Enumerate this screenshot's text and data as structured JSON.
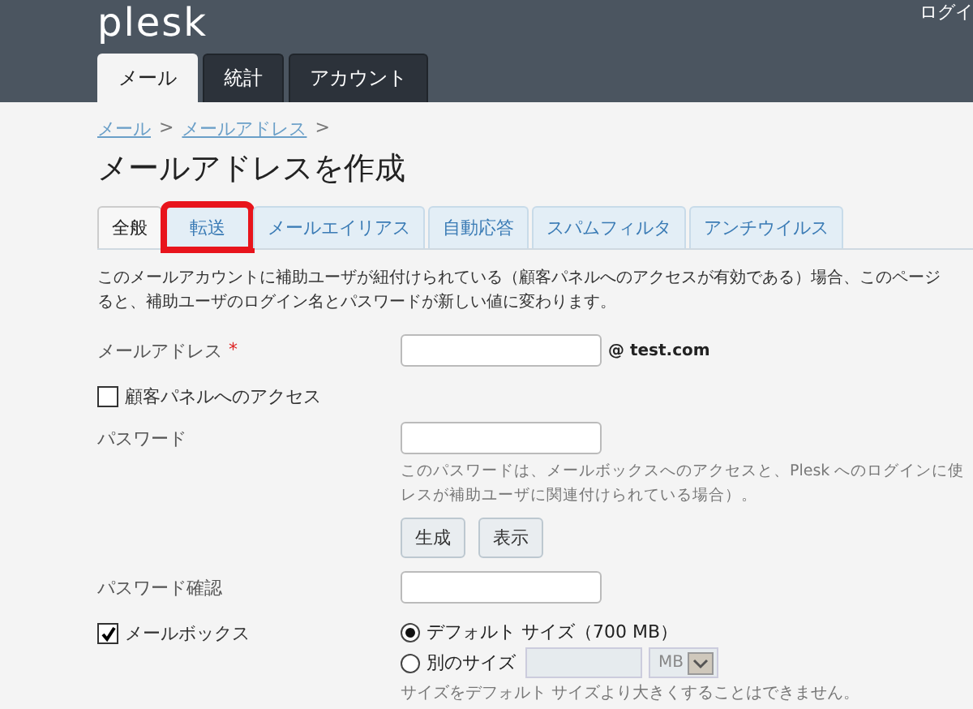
{
  "header": {
    "logo": "plesk",
    "user_text": "ログイ",
    "nav_tabs": [
      {
        "label": "メール",
        "selected": true
      },
      {
        "label": "統計",
        "selected": false
      },
      {
        "label": "アカウント",
        "selected": false
      }
    ]
  },
  "breadcrumb": [
    {
      "kind": "link",
      "text": "メール"
    },
    {
      "kind": "sep",
      "text": ">"
    },
    {
      "kind": "link",
      "text": "メールアドレス"
    },
    {
      "kind": "sep",
      "text": ">"
    }
  ],
  "title": "メールアドレスを作成",
  "tabs": [
    {
      "label": "全般",
      "selected": true,
      "highlighted": false
    },
    {
      "label": "転送",
      "selected": false,
      "highlighted": true
    },
    {
      "label": "メールエイリアス",
      "selected": false,
      "highlighted": false
    },
    {
      "label": "自動応答",
      "selected": false,
      "highlighted": false
    },
    {
      "label": "スパムフィルタ",
      "selected": false,
      "highlighted": false
    },
    {
      "label": "アンチウイルス",
      "selected": false,
      "highlighted": false
    }
  ],
  "description": [
    "このメールアカウントに補助ユーザが紐付けられている（顧客パネルへのアクセスが有効である）場合、このページ",
    "ると、補助ユーザのログイン名とパスワードが新しい値に変わります。"
  ],
  "fields": [
    {
      "kind": "text",
      "label": "メールアドレス",
      "required_mark": "*",
      "suffix": "@ test.com"
    },
    {
      "kind": "checkbox",
      "label": "顧客パネルへのアクセス",
      "checked": false
    },
    {
      "kind": "password",
      "label": "パスワード",
      "hint": [
        "このパスワードは、メールボックスへのアクセスと、Plesk へのログインに使",
        "レスが補助ユーザに関連付けられている場合）。"
      ],
      "buttons": [
        "生成",
        "表示"
      ]
    },
    {
      "kind": "text",
      "label": "パスワード確認"
    },
    {
      "kind": "mailbox",
      "label": "メールボックス",
      "checked": true,
      "options": [
        {
          "label": "デフォルト サイズ（700 MB）",
          "selected": true
        },
        {
          "label": "別のサイズ",
          "selected": false,
          "unit": "MB"
        }
      ],
      "note": "サイズをデフォルト サイズより大きくすることはできません。"
    }
  ]
}
